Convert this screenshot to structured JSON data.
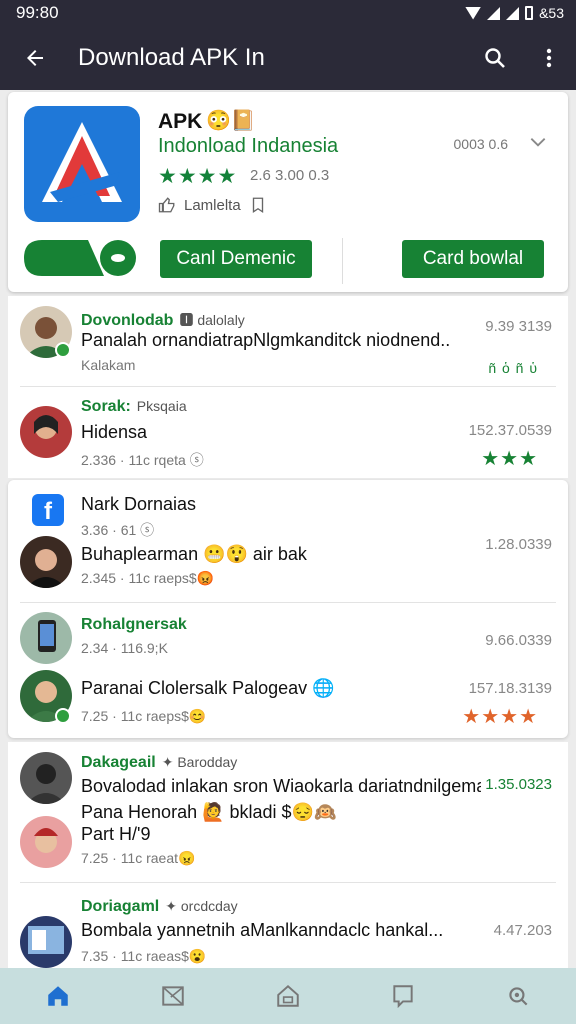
{
  "status": {
    "time": "99:80",
    "right": "&53"
  },
  "appbar": {
    "title": "Download APK In",
    "back_icon": "back-arrow-icon",
    "search_icon": "search-icon",
    "menu_icon": "more-vert-icon"
  },
  "app": {
    "name": "APK",
    "emoji": "😳📔",
    "subtitle": "Indonload Indanesia",
    "stars": "★★★★",
    "rating_text": "2.6 3.00 0.3",
    "like_text": "Lamlelta",
    "size_text": "0003 0.6",
    "btn_left": "Canl Demenic",
    "btn_right": "Card bowlal",
    "accent": "#178234"
  },
  "posts": [
    {
      "user": "Dovonlodab",
      "tag": "🅸 dalolaly",
      "body": "Panalah ornandiatrapNlgmkanditck niodnend..",
      "meta": "Kalakam",
      "num": "9.39 3139",
      "stars": "ñ ὁ ñ ὑ"
    },
    {
      "user": "Sorak:",
      "tag": "Pksqaia",
      "body": "Hidensa",
      "meta": "2.336 · 11c rqeta ⓢ",
      "num": "152.37.0539",
      "stars": "★★★"
    },
    {
      "user": "Nark Dornaias",
      "tag": "",
      "body": "Buhaplearman 😬😲 air bak",
      "meta": "2.345 · 11c raeps$😡",
      "meta2": "3.36 · 61 ⓢ",
      "num": "1.28.0339",
      "stars": ""
    },
    {
      "user": "Rohalgnersak",
      "tag": "",
      "body": "",
      "meta": "2.34 · 116.9;K",
      "num": "9.66.0339",
      "stars": ""
    },
    {
      "user": "",
      "tag": "",
      "body": "Paranai Clolersalk Palogeav 🌐",
      "meta": "7.25 · 11c raeps$😊",
      "num": "157.18.3139",
      "stars": "★★★★"
    },
    {
      "user": "Dakageail",
      "tag": "✦ Barodday",
      "body": "Bovalodad inlakan sron Wiaokarla dariatndnilgemak..",
      "body2": "Pana Henorah 🙋 bkladi $😔🙉",
      "body3": "Part H/'9",
      "meta": "7.25 · 11c raeat😠",
      "num": "1.35.0323",
      "stars": ""
    },
    {
      "user": "Doriagaml",
      "tag": "✦ orcdcday",
      "body": "Bombala yannetnih aManlkanndaclc hankal...",
      "meta": "7.35 · 11c raeas$😮",
      "num": "4.47.203",
      "stars": ""
    }
  ],
  "nav": {
    "items": [
      "home-icon",
      "image-icon",
      "home-outline-icon",
      "bookmark-icon",
      "settings-icon"
    ]
  }
}
